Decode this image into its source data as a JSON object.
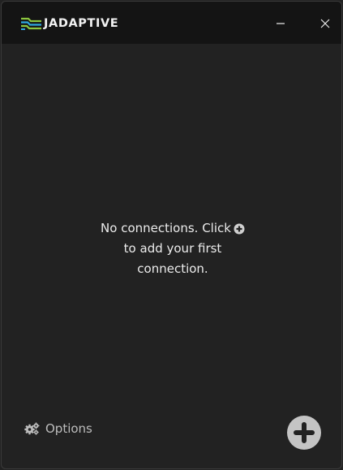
{
  "app": {
    "brand": "JADAPTIVE"
  },
  "titlebar": {
    "minimize_icon": "minimize-icon",
    "close_icon": "close-icon"
  },
  "empty_state": {
    "line1": "No connections. Click",
    "line2": "to add your first",
    "line3": "connection.",
    "inline_icon": "add-circle-icon"
  },
  "footer": {
    "options_label": "Options",
    "options_icon": "gears-icon",
    "add_icon": "add-circle-icon"
  },
  "colors": {
    "background": "#222222",
    "titlebar": "#141414",
    "logo_green": "#8cc63f",
    "logo_blue": "#2fa8e0",
    "text": "#ececec",
    "muted_text": "#bdbdbd",
    "fab": "#c4c4c4"
  }
}
